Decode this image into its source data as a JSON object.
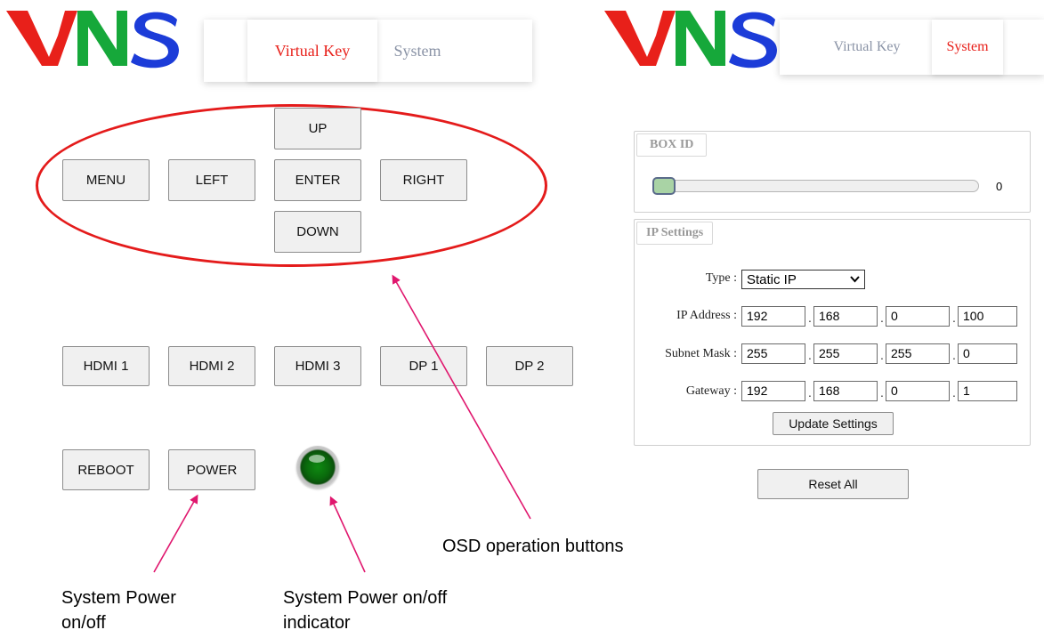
{
  "logo": {
    "text": "VNS",
    "colors": [
      "#e8201a",
      "#16a83a",
      "#1c3cd8"
    ]
  },
  "left_nav": {
    "tabs": [
      {
        "label": "Virtual Key",
        "active": true
      },
      {
        "label": "System",
        "active": false
      }
    ]
  },
  "right_nav": {
    "tabs": [
      {
        "label": "Virtual Key",
        "active": false
      },
      {
        "label": "System",
        "active": true
      }
    ]
  },
  "osd_buttons": {
    "up": "UP",
    "menu": "MENU",
    "left": "LEFT",
    "enter": "ENTER",
    "right": "RIGHT",
    "down": "DOWN"
  },
  "source_buttons": {
    "hdmi1": "HDMI 1",
    "hdmi2": "HDMI 2",
    "hdmi3": "HDMI 3",
    "dp1": "DP 1",
    "dp2": "DP 2"
  },
  "system_buttons": {
    "reboot": "REBOOT",
    "power": "POWER"
  },
  "power_indicator": {
    "state": "on",
    "color": "#0a6a0c"
  },
  "annotations": {
    "osd": "OSD operation buttons",
    "power_line1": "System Power",
    "power_line2": "on/off",
    "indicator_line1": "System Power on/off",
    "indicator_line2": "indicator",
    "arrow_color": "#e0176e",
    "ellipse_color": "#e41b1b"
  },
  "box_id": {
    "legend": "BOX ID",
    "value": "0",
    "fraction": 0.0
  },
  "ip_settings": {
    "legend": "IP Settings",
    "type_label": "Type :",
    "type_value": "Static IP",
    "ip_label": "IP Address :",
    "ip": [
      "192",
      "168",
      "0",
      "100"
    ],
    "mask_label": "Subnet Mask :",
    "mask": [
      "255",
      "255",
      "255",
      "0"
    ],
    "gateway_label": "Gateway :",
    "gateway": [
      "192",
      "168",
      "0",
      "1"
    ],
    "update_button": "Update Settings"
  },
  "reset_button": "Reset All"
}
